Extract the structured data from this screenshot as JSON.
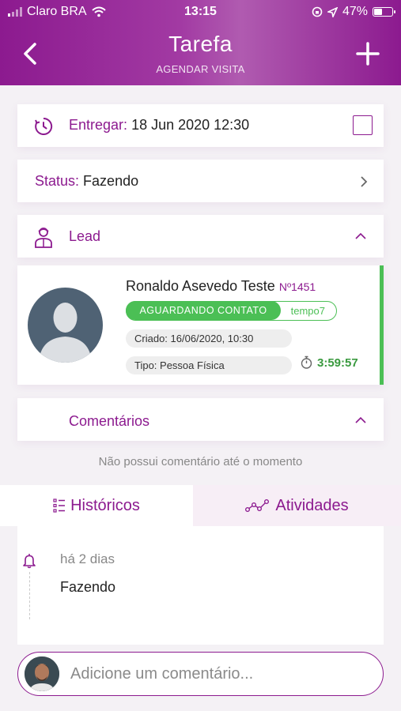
{
  "status_bar": {
    "carrier": "Claro BRA",
    "time": "13:15",
    "battery": "47%",
    "battery_level": 0.47
  },
  "header": {
    "title": "Tarefa",
    "subtitle": "AGENDAR VISITA"
  },
  "deliver": {
    "label": "Entregar:",
    "value": "18 Jun 2020 12:30"
  },
  "status": {
    "label": "Status:",
    "value": "Fazendo"
  },
  "lead_section": {
    "label": "Lead"
  },
  "lead": {
    "name": "Ronaldo Asevedo Teste",
    "number": "Nº1451",
    "status_badge": "AGUARDANDO CONTATO",
    "status_tag": "tempo7",
    "created": "Criado: 16/06/2020, 10:30",
    "type": "Tipo: Pessoa Física",
    "timer": "3:59:57"
  },
  "comments": {
    "label": "Comentários",
    "empty_text": "Não possui comentário até o momento"
  },
  "tabs": [
    {
      "label": "Históricos"
    },
    {
      "label": "Atividades"
    }
  ],
  "timeline": [
    {
      "when": "há 2 dias",
      "what": "Fazendo"
    }
  ],
  "comment_box": {
    "placeholder": "Adicione um comentário..."
  },
  "colors": {
    "primary": "#8c1a8f",
    "success": "#4bbf55",
    "timer": "#3a9a3f"
  }
}
